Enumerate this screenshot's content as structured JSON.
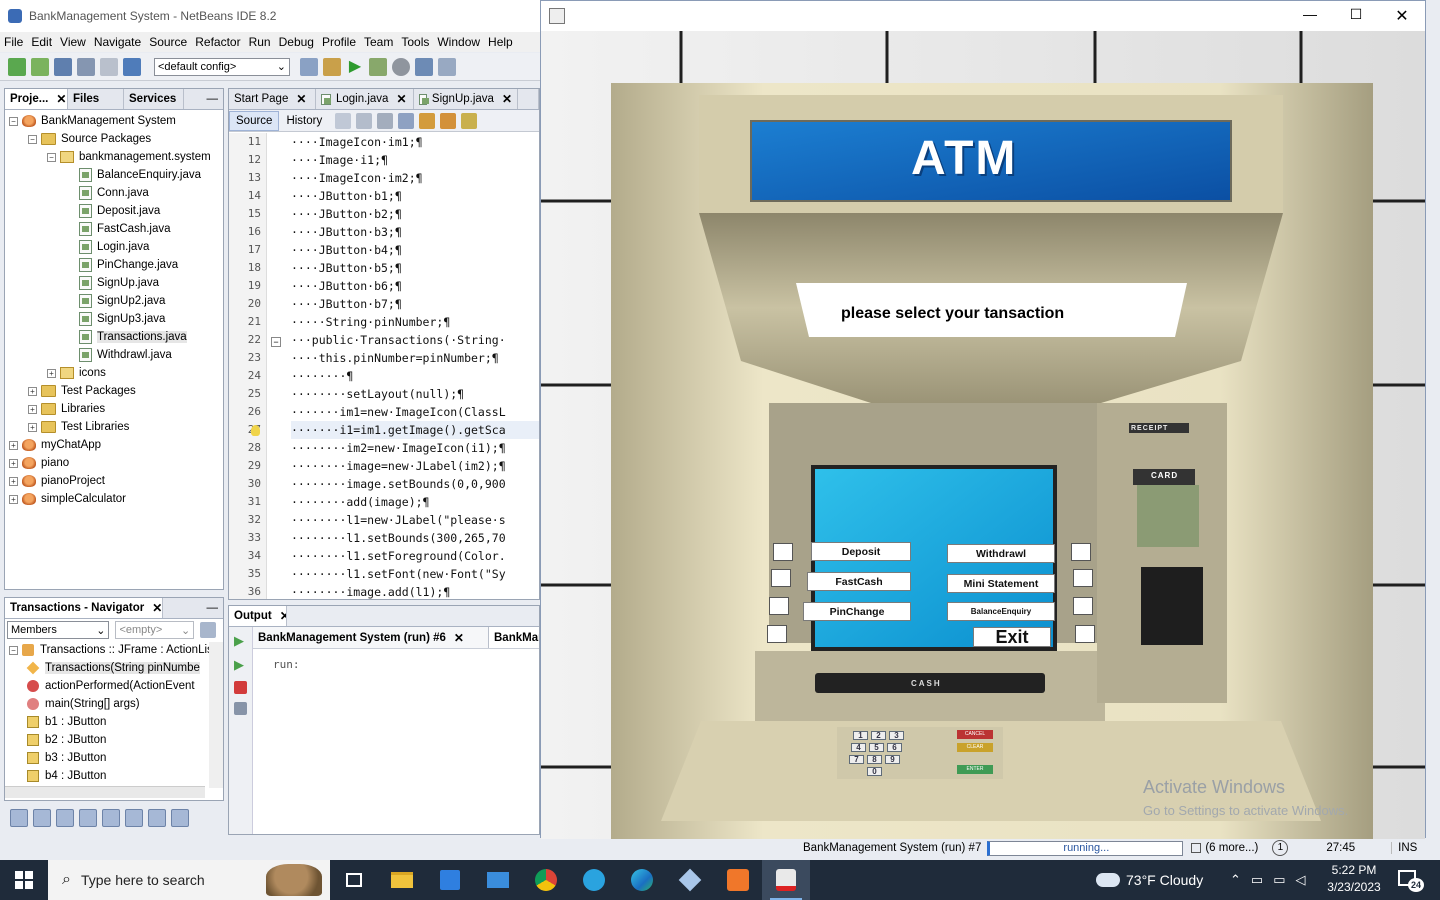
{
  "ide": {
    "window_title": "BankManagement System - NetBeans IDE 8.2",
    "menu": [
      "File",
      "Edit",
      "View",
      "Navigate",
      "Source",
      "Refactor",
      "Run",
      "Debug",
      "Profile",
      "Team",
      "Tools",
      "Window",
      "Help"
    ],
    "config_value": "<default config>",
    "left_tabs": [
      {
        "label": "Proje...",
        "close": "✕"
      },
      {
        "label": "Files"
      },
      {
        "label": "Services"
      }
    ],
    "project_tree": [
      {
        "label": "BankManagement System",
        "indent": 0,
        "icon": "project-icon",
        "exp": "−"
      },
      {
        "label": "Source Packages",
        "indent": 1,
        "icon": "folder-icon",
        "exp": "−"
      },
      {
        "label": "bankmanagement.system",
        "indent": 2,
        "icon": "package-icon",
        "exp": "−"
      },
      {
        "label": "BalanceEnquiry.java",
        "indent": 3,
        "icon": "java-file-icon"
      },
      {
        "label": "Conn.java",
        "indent": 3,
        "icon": "java-file-icon"
      },
      {
        "label": "Deposit.java",
        "indent": 3,
        "icon": "java-file-icon"
      },
      {
        "label": "FastCash.java",
        "indent": 3,
        "icon": "java-file-icon"
      },
      {
        "label": "Login.java",
        "indent": 3,
        "icon": "java-file-icon"
      },
      {
        "label": "PinChange.java",
        "indent": 3,
        "icon": "java-file-icon"
      },
      {
        "label": "SignUp.java",
        "indent": 3,
        "icon": "java-file-icon"
      },
      {
        "label": "SignUp2.java",
        "indent": 3,
        "icon": "java-file-icon"
      },
      {
        "label": "SignUp3.java",
        "indent": 3,
        "icon": "java-file-icon"
      },
      {
        "label": "Transactions.java",
        "indent": 3,
        "icon": "java-file-icon",
        "selected": true
      },
      {
        "label": "Withdrawl.java",
        "indent": 3,
        "icon": "java-file-icon"
      },
      {
        "label": "icons",
        "indent": 2,
        "icon": "package-icon",
        "exp": "+"
      },
      {
        "label": "Test Packages",
        "indent": 1,
        "icon": "folder-icon",
        "exp": "+"
      },
      {
        "label": "Libraries",
        "indent": 1,
        "icon": "folder-icon",
        "exp": "+"
      },
      {
        "label": "Test Libraries",
        "indent": 1,
        "icon": "folder-icon",
        "exp": "+"
      },
      {
        "label": "myChatApp",
        "indent": 0,
        "icon": "project-icon",
        "exp": "+"
      },
      {
        "label": "piano",
        "indent": 0,
        "icon": "project-icon",
        "exp": "+"
      },
      {
        "label": "pianoProject",
        "indent": 0,
        "icon": "project-icon",
        "exp": "+"
      },
      {
        "label": "simpleCalculator",
        "indent": 0,
        "icon": "project-icon",
        "exp": "+"
      }
    ],
    "navigator": {
      "title": "Transactions - Navigator",
      "filter": "Members",
      "filter2": "<empty>",
      "items": [
        {
          "label": "Transactions :: JFrame : ActionLis",
          "indent": 0
        },
        {
          "label": "Transactions(String pinNumbe",
          "indent": 1,
          "selected": true
        },
        {
          "label": "actionPerformed(ActionEvent",
          "indent": 1
        },
        {
          "label": "main(String[] args)",
          "indent": 1
        },
        {
          "label": "b1 : JButton",
          "indent": 1
        },
        {
          "label": "b2 : JButton",
          "indent": 1
        },
        {
          "label": "b3 : JButton",
          "indent": 1
        },
        {
          "label": "b4 : JButton",
          "indent": 1
        }
      ]
    },
    "editor_tabs": [
      "Start Page",
      "Login.java",
      "SignUp.java"
    ],
    "source_btn": "Source",
    "history_btn": "History",
    "line_numbers": [
      "11",
      "12",
      "13",
      "14",
      "15",
      "16",
      "17",
      "18",
      "19",
      "20",
      "21",
      "22",
      "23",
      "24",
      "25",
      "26",
      "27",
      "28",
      "29",
      "30",
      "31",
      "32",
      "33",
      "34",
      "35",
      "36"
    ],
    "code": [
      "····ImageIcon·im1;¶",
      "····Image·i1;¶",
      "····ImageIcon·im2;¶",
      "····JButton·b1;¶",
      "····JButton·b2;¶",
      "····JButton·b3;¶",
      "····JButton·b4;¶",
      "····JButton·b5;¶",
      "····JButton·b6;¶",
      "····JButton·b7;¶",
      "·····String·pinNumber;¶",
      "···public·Transactions(·String·",
      "····this.pinNumber=pinNumber;¶",
      "········¶",
      "········setLayout(null);¶",
      "·······im1=new·ImageIcon(ClassL",
      "·······i1=im1.getImage().getSca",
      "········im2=new·ImageIcon(i1);¶",
      "········image=new·JLabel(im2);¶",
      "········image.setBounds(0,0,900",
      "········add(image);¶",
      "········l1=new·JLabel(\"please·s",
      "········l1.setBounds(300,265,70",
      "········l1.setForeground(Color.",
      "········l1.setFont(new·Font(\"Sy",
      "········image.add(l1);¶"
    ],
    "output": {
      "title": "Output",
      "tab1": "BankManagement System (run) #6",
      "tab2": "BankMan",
      "text": "run:"
    },
    "status": {
      "task": "BankManagement System (run) #7",
      "progress": "running...",
      "more": "(6 more...)",
      "badge": "1",
      "position": "27:45",
      "mode": "INS"
    }
  },
  "atm": {
    "header": "ATM",
    "message": "please select your tansaction",
    "buttons": {
      "deposit": "Deposit",
      "withdrawl": "Withdrawl",
      "fastcash": "FastCash",
      "ministatement": "Mini Statement",
      "pinchange": "PinChange",
      "balance": "BalanceEnquiry",
      "exit": "Exit"
    },
    "receipt_label": "RECEIPT",
    "card_label": "CARD",
    "cash_label": "CASH",
    "keypad": [
      "1",
      "2",
      "3",
      "4",
      "5",
      "6",
      "7",
      "8",
      "9",
      "0"
    ],
    "pad_side": [
      "CANCEL",
      "CLEAR",
      "ENTER"
    ],
    "watermark_title": "Activate Windows",
    "watermark_sub": "Go to Settings to activate Windows."
  },
  "taskbar": {
    "search_placeholder": "Type here to search",
    "weather": "73°F  Cloudy",
    "time": "5:22 PM",
    "date": "3/23/2023",
    "notif_count": "24"
  }
}
